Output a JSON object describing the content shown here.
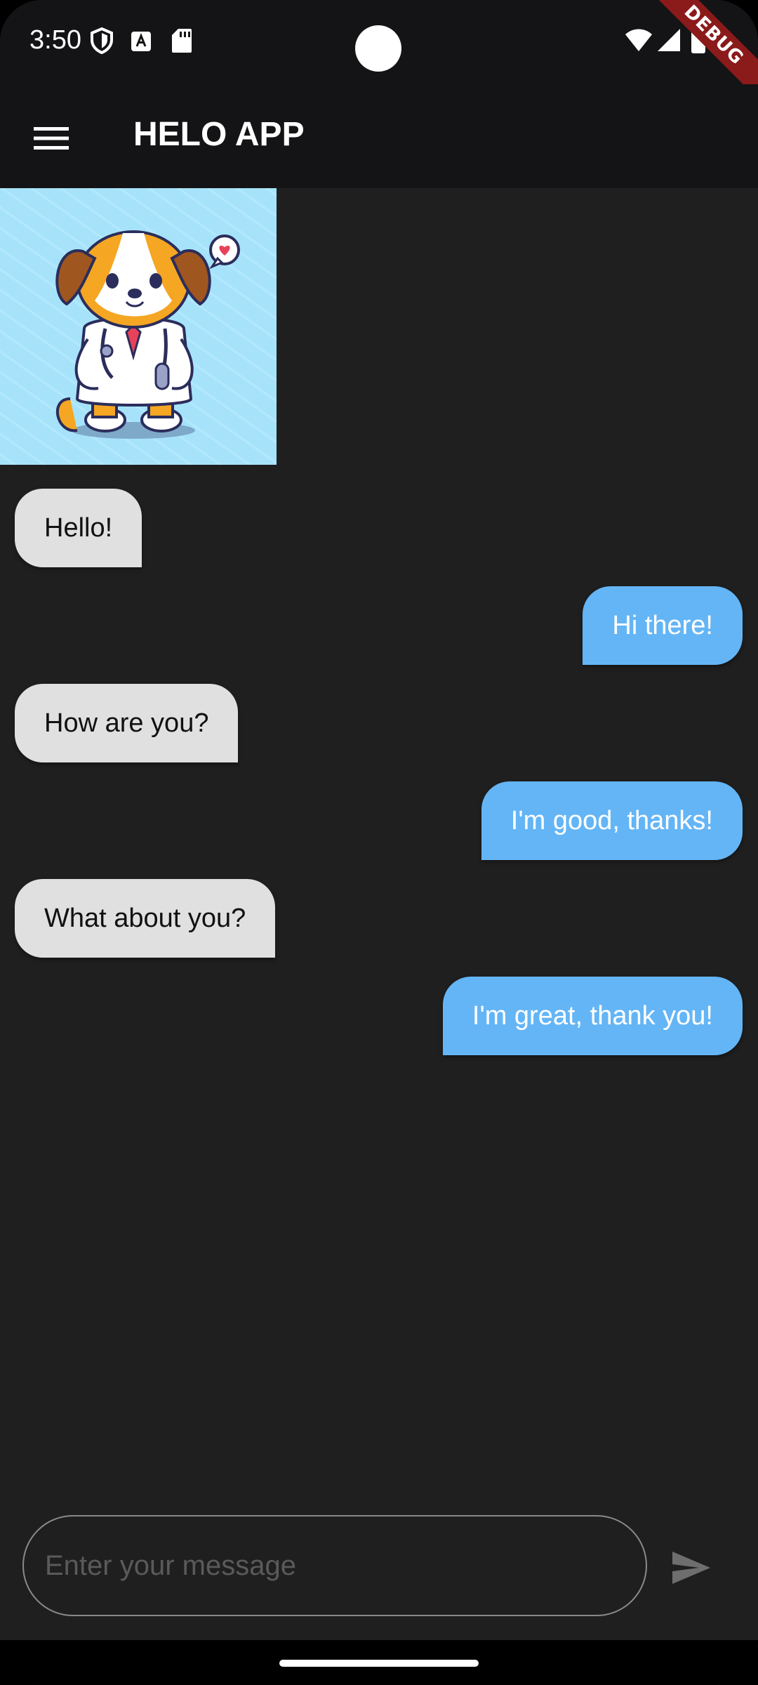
{
  "status_bar": {
    "time": "3:50",
    "icons": [
      "shield-icon",
      "a-keyboard-icon",
      "sd-card-icon",
      "wifi-icon",
      "signal-icon",
      "battery-icon"
    ],
    "debug_label": "DEBUG"
  },
  "app_bar": {
    "title": "HELO APP",
    "menu_icon": "hamburger-menu-icon"
  },
  "header_image": {
    "subject": "cartoon-dog-doctor",
    "background_color": "#a6e3fb"
  },
  "messages": [
    {
      "sender": "other",
      "text": "Hello!"
    },
    {
      "sender": "me",
      "text": "Hi there!"
    },
    {
      "sender": "other",
      "text": "How are you?"
    },
    {
      "sender": "me",
      "text": "I'm good, thanks!"
    },
    {
      "sender": "other",
      "text": "What about you?"
    },
    {
      "sender": "me",
      "text": "I'm great, thank you!"
    }
  ],
  "composer": {
    "placeholder": "Enter your message",
    "value": "",
    "send_icon": "send-icon"
  },
  "colors": {
    "incoming_bubble": "#e0e0e0",
    "outgoing_bubble": "#64b5f6",
    "background": "#1f1f1f",
    "app_bar": "#141416"
  }
}
